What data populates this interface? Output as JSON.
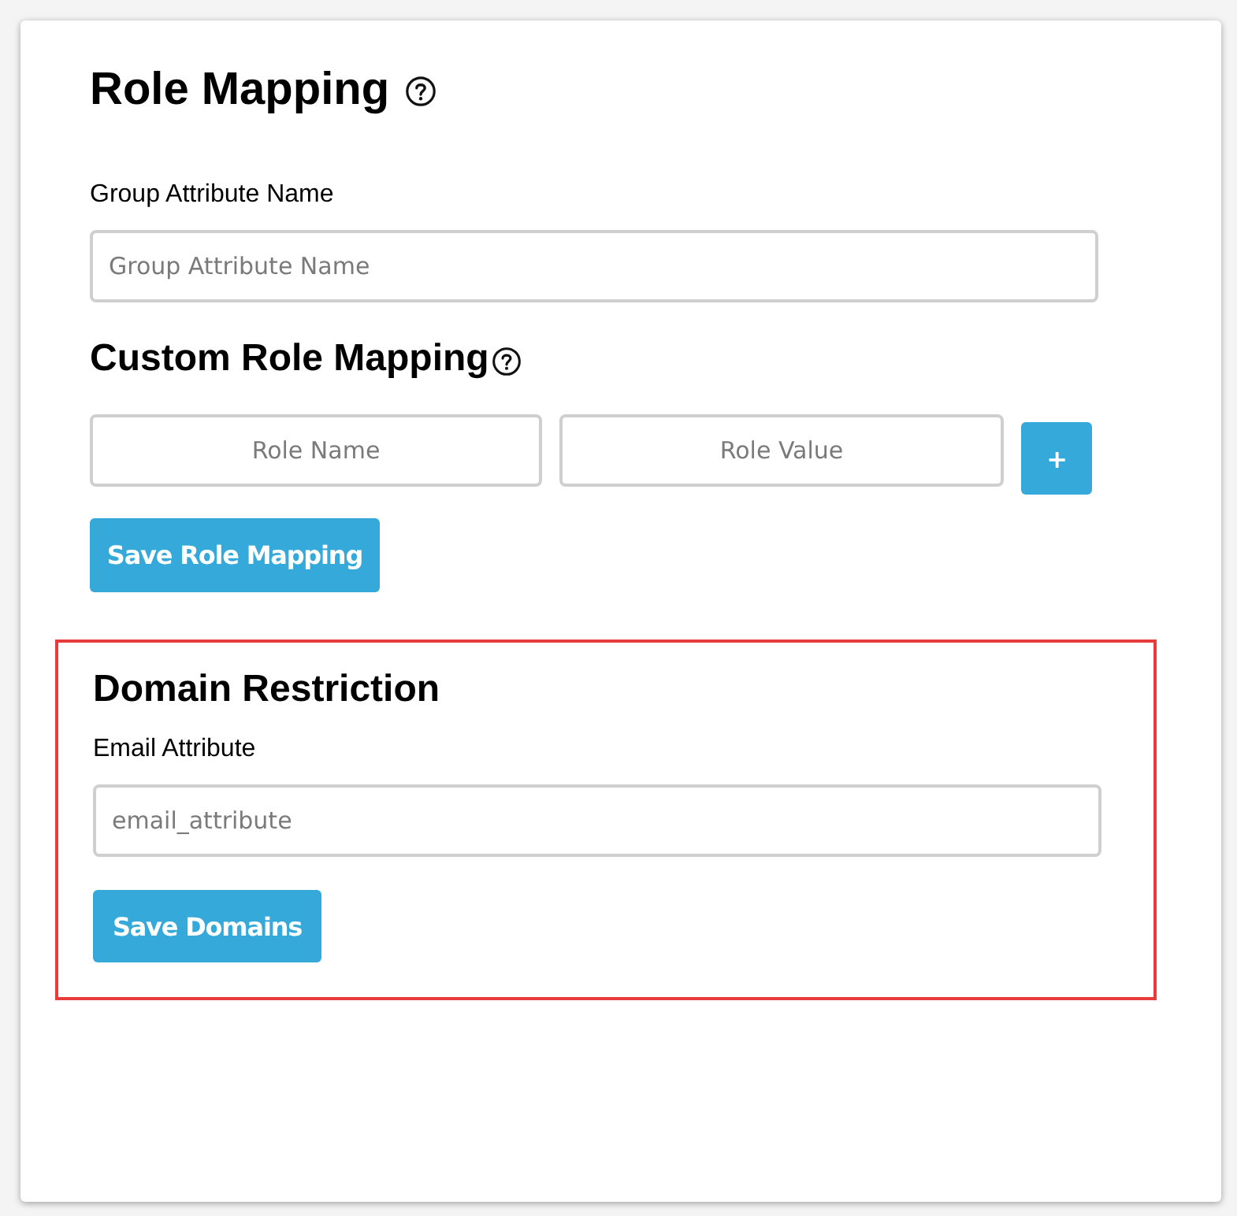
{
  "role_mapping": {
    "title": "Role Mapping",
    "help_icon": true,
    "field_label": "Group Attribute Name",
    "field": {
      "placeholder": "Group Attribute Name"
    }
  },
  "custom_role_mapping": {
    "title": "Custom Role Mapping",
    "help_icon": true,
    "fields": [
      {
        "placeholder": "Role Name"
      },
      {
        "placeholder": "Role Value"
      }
    ],
    "add_button": "+",
    "save_button": "Save Role Mapping"
  },
  "domain_restriction": {
    "highlighted": true,
    "title": "Domain Restriction",
    "field_label": "Email Attribute",
    "field": {
      "placeholder": "email_attribute"
    },
    "save_button": "Save Domains"
  }
}
